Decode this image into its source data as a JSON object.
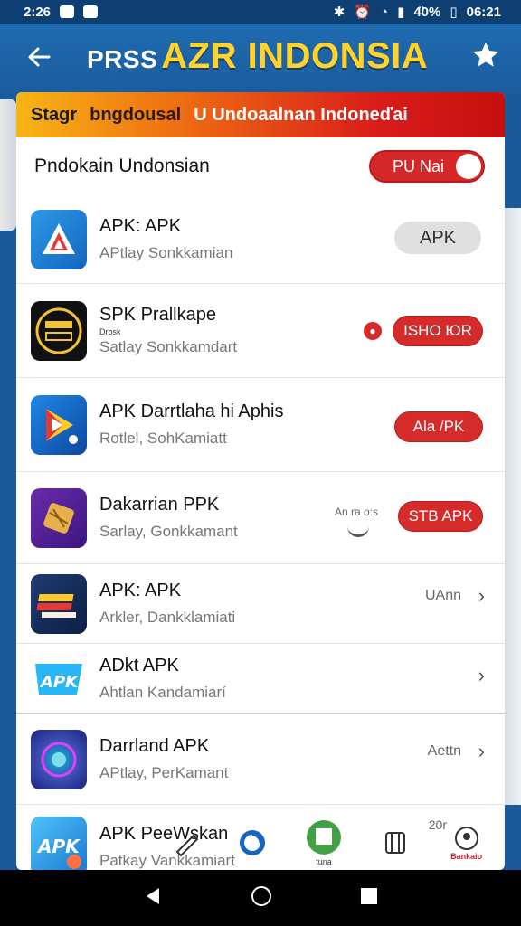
{
  "status_bar": {
    "time": "2:26",
    "battery": "4̈0%",
    "clock_right": "06:21"
  },
  "app_bar": {
    "title_prefix": "PRSS",
    "title_main": "AZR INDONSIA"
  },
  "banner": {
    "part1": "Stagr",
    "part2": "bngdousal",
    "part3": "U Undoaalnan Indoneďai"
  },
  "section": {
    "title": "Pndokain Undonsian",
    "toggle_label": "PU Nai"
  },
  "apps": [
    {
      "name": "APK: APK",
      "sub": "APtlay Sonkkamian",
      "action": "APK",
      "action_style": "grey"
    },
    {
      "name": "SPK Prallkape",
      "sub": "Satlay Sonkkamdart",
      "action": "ISHO ЮR",
      "action_style": "red",
      "small_tag": "Drosk"
    },
    {
      "name": "APK Darrtlaha hi Aphis",
      "sub": "Rotlel, SohKamiatt",
      "action": "Ala /PK",
      "action_style": "red"
    },
    {
      "name": "Dakarrian PPK",
      "sub": "Sarlay, Gonkkamant",
      "action": "STB APK",
      "action_style": "red",
      "side_label": "An ra o:s"
    },
    {
      "name": "APK: APK",
      "sub": "Arkler, Dankklamiati",
      "action": "UAnn",
      "action_style": "chevron"
    },
    {
      "name": "ADkt APK",
      "sub": "Ahtlan Kandamiarí",
      "action": "",
      "action_style": "chevron"
    },
    {
      "name": "Darrland APK",
      "sub": "APtlay, PerKamant",
      "action": "Aettn",
      "action_style": "chevron"
    },
    {
      "name": "APK PeeWskan",
      "sub": "Patkay Vankkamiart",
      "action": "20r",
      "action_style": "tabs"
    }
  ],
  "bottom_tabs": {
    "chat_label": "tuna",
    "right_label": "Bankaio"
  },
  "colors": {
    "appbar": "#1f6bb0",
    "title_yellow": "#ffd32a",
    "accent_red": "#d62b2b"
  }
}
